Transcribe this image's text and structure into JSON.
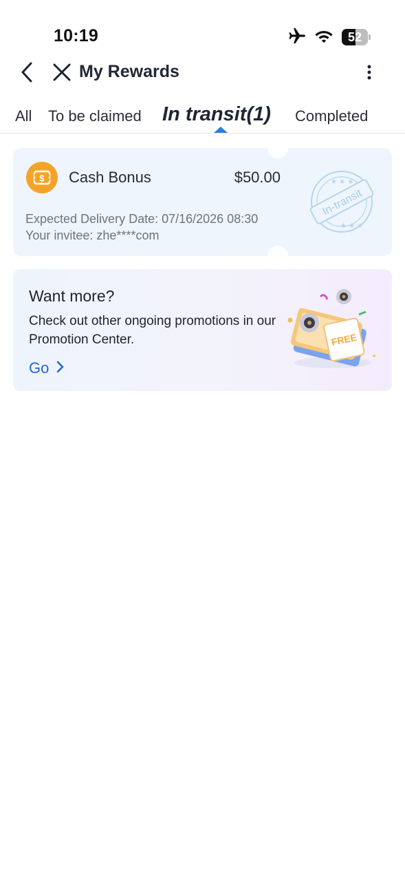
{
  "status_bar": {
    "time": "10:19",
    "battery_level": "52",
    "battery_fraction": 0.52,
    "icons": [
      "airplane-icon",
      "wifi-icon",
      "battery-icon"
    ]
  },
  "header": {
    "title": "My Rewards",
    "icons": [
      "chevron-left-icon",
      "close-icon",
      "more-vertical-icon"
    ]
  },
  "tabs": [
    {
      "label": "All",
      "active": false
    },
    {
      "label": "To be claimed",
      "active": false
    },
    {
      "label": "In transit(1)",
      "active": true
    },
    {
      "label": "Completed",
      "active": false
    }
  ],
  "reward": {
    "name": "Cash Bonus",
    "amount": "$50.00",
    "delivery_date": "Expected Delivery Date: 07/16/2026 08:30",
    "invitee": "Your invitee: zhe****com",
    "stamp_text": "In-transit",
    "icon": "cash-bonus-icon"
  },
  "promo": {
    "title": "Want more?",
    "description": "Check out other ongoing promotions in our Promotion Center.",
    "link_label": "Go",
    "illustration_text": "FREE"
  },
  "colors": {
    "accent": "#2a7fe0",
    "link": "#2466d0",
    "bonus_orange": "#f4a32a",
    "card_background": "#eef5fd",
    "stamp": "#a9cdea"
  }
}
